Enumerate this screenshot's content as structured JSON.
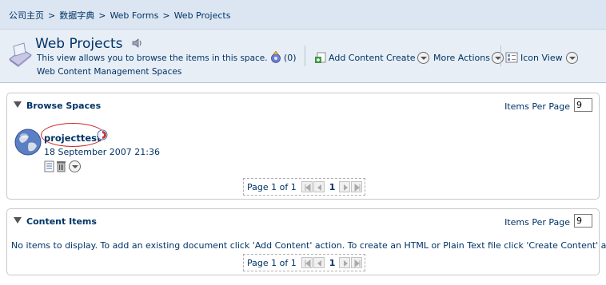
{
  "breadcrumb": {
    "items": [
      "公司主页",
      "数据字典",
      "Web Forms",
      "Web Projects"
    ],
    "separator": ">"
  },
  "header": {
    "title": "Web Projects",
    "description": "This view allows you to browse the items in this space.",
    "subtitle": "Web Content Management Spaces",
    "rss_count": "(0)",
    "actions": {
      "add_content": "Add Content",
      "create": "Create",
      "more_actions": "More Actions",
      "icon_view": "Icon View"
    }
  },
  "browse_spaces": {
    "title": "Browse Spaces",
    "items_per_page_label": "Items Per Page",
    "items_per_page_value": "9",
    "items": [
      {
        "name": "projecttest",
        "date": "18 September 2007 21:36"
      }
    ],
    "pager": {
      "text": "Page 1 of 1",
      "current": "1"
    }
  },
  "content_items": {
    "title": "Content Items",
    "items_per_page_label": "Items Per Page",
    "items_per_page_value": "9",
    "empty_message": "No items to display. To add an existing document click 'Add Content' action. To create an HTML or Plain Text file click 'Create Content' action.",
    "pager": {
      "text": "Page 1 of 1",
      "current": "1"
    }
  },
  "colors": {
    "breadcrumb_bg": "#dce6f2",
    "header_bg": "#e8eef6",
    "text": "#003366",
    "highlight_oval": "#cc2a2a"
  },
  "icons": [
    "space-icon",
    "speaker-icon",
    "rss-icon",
    "add-content-icon",
    "view-icon",
    "globe-icon",
    "info-icon",
    "details-icon",
    "delete-icon",
    "more-icon",
    "first-page-icon",
    "prev-page-icon",
    "next-page-icon",
    "last-page-icon"
  ]
}
